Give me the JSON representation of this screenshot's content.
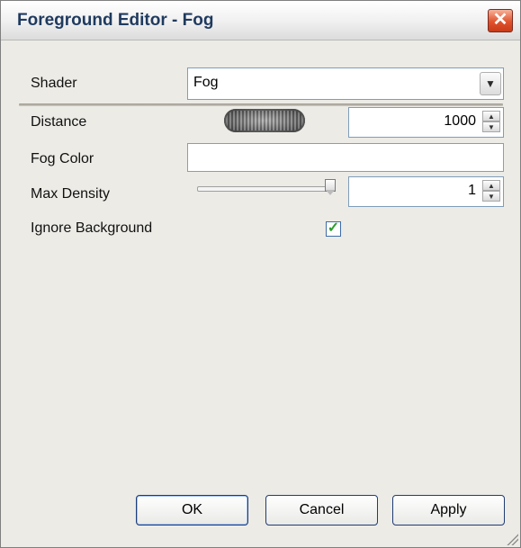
{
  "window": {
    "title": "Foreground Editor - Fog"
  },
  "fields": {
    "shader": {
      "label": "Shader",
      "value": "Fog"
    },
    "distance": {
      "label": "Distance",
      "value": "1000"
    },
    "fog_color": {
      "label": "Fog Color",
      "value": ""
    },
    "max_density": {
      "label": "Max Density",
      "value": "1",
      "slider_level": 1.0
    },
    "ignore_background": {
      "label": "Ignore Background",
      "checked": true
    }
  },
  "buttons": {
    "ok": "OK",
    "cancel": "Cancel",
    "apply": "Apply"
  },
  "icons": {
    "close": "close-icon",
    "dropdown": "chevron-down-icon",
    "spin_up": "arrow-up-icon",
    "spin_down": "arrow-down-icon",
    "check": "check-icon",
    "resize": "resize-grip-icon"
  },
  "colors": {
    "title_text": "#1f3a5f",
    "close_button": "#e0522c",
    "check_mark": "#2e9e2e",
    "dialog_background": "#ecebe6"
  }
}
